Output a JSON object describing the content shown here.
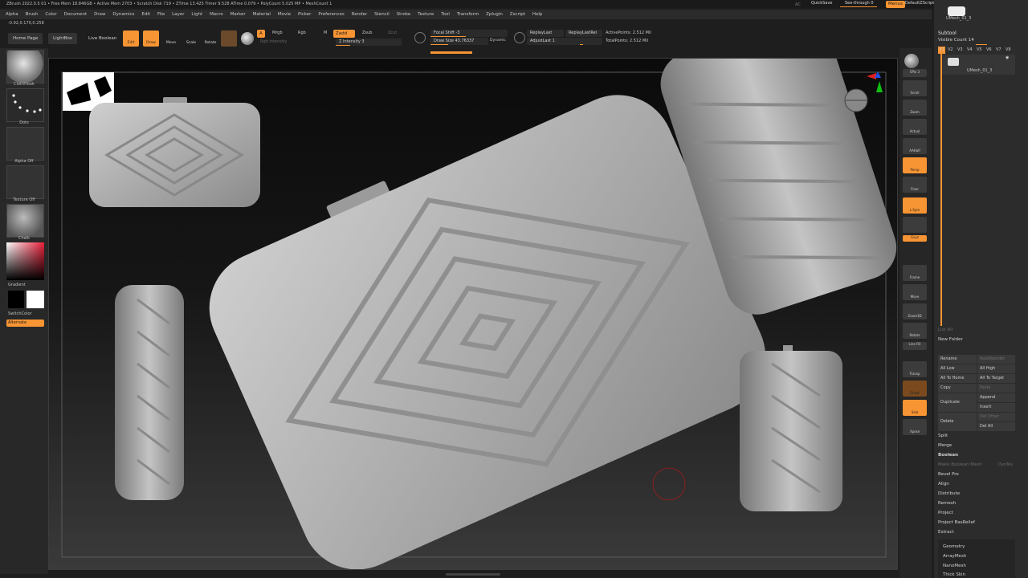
{
  "title_bar": "ZBrush 2022.0.5   01  • Free Mem 18.846GB • Active Mem 2703 • Scratch Disk 719 • ZTime 13.425 Timer 9.528 ATime 0.079 • PolyCount 5.025 MP • MeshCount 1",
  "window_controls": {
    "ac": "AC",
    "quicksave": "QuickSave",
    "see_through": "See-through  0",
    "menus": "Menus",
    "script": "DefaultZScript"
  },
  "menu": [
    "Alpha",
    "Brush",
    "Color",
    "Document",
    "Draw",
    "Dynamics",
    "Edit",
    "File",
    "Layer",
    "Light",
    "Macro",
    "Marker",
    "Material",
    "Movie",
    "Picker",
    "Preferences",
    "Render",
    "Stencil",
    "Stroke",
    "Texture",
    "Tool",
    "Transform",
    "Zplugin",
    "Zscript",
    "Help"
  ],
  "coords": "-0.92,0.170,0.258",
  "toolbar": {
    "home_page": "Home Page",
    "lightbox": "LightBox",
    "live_boolean": "Live Boolean",
    "edit": "Edit",
    "draw": "Draw",
    "move": "Move",
    "scale": "Scale",
    "rotate": "Rotate",
    "a": "A",
    "mrgb": "Mrgb",
    "rgb": "Rgb",
    "m": "M",
    "zadd": "Zadd",
    "zsub": "Zsub",
    "zcut": "Zcut",
    "rgb_intensity": "Rgb Intensity",
    "z_intensity": "Z Intensity 3",
    "focal_shift": "Focal Shift -3",
    "draw_size": "Draw Size 43.76337",
    "dynamic": "Dynamic",
    "replay_last": "ReplayLast",
    "replay_last_rel": "ReplayLastRel",
    "adjust_last": "AdjustLast 1",
    "active_points": "ActivePoints: 2.512 Mil",
    "total_points": "TotalPoints: 2.512 Mil"
  },
  "left_panel": {
    "brush": "ClothHook",
    "stroke": "Dots",
    "alpha": "Alpha Off",
    "texture": "Texture Off",
    "material": "Chalk",
    "gradient": "Gradient",
    "switch_color": "SwitchColor",
    "alternate": "Alternate"
  },
  "right_shelf": [
    "SPix 3",
    "Scroll",
    "Zoom",
    "Actual",
    "AAHalf",
    "Persp",
    "Floor",
    "L.Sym",
    "Gxyz",
    "Frame",
    "Move",
    "Zoom3D",
    "Rotate",
    "Line Fill",
    "PolyF",
    "Transp",
    "Ghost",
    "Solo",
    "Xpose"
  ],
  "subtool": {
    "tool_name": "UMesh_01_3",
    "header": "Subtool",
    "visible_count": "Visible Count 14",
    "versions": [
      "V1",
      "V2",
      "V3",
      "V4",
      "V5",
      "V6",
      "V7",
      "V8"
    ],
    "item_name": "UMesh_01_3",
    "list_all": "List All",
    "new_folder": "New Folder",
    "buttons": [
      [
        "Rename",
        "AutoReorder"
      ],
      [
        "All Low",
        "All High"
      ],
      [
        "All To Home",
        "All To Target"
      ],
      [
        "Copy",
        "Paste"
      ],
      [
        "Duplicate",
        "Append"
      ],
      [
        "",
        "Insert"
      ],
      [
        "Delete",
        "Del Other"
      ],
      [
        "",
        "Del All"
      ]
    ],
    "list": [
      "Split",
      "Merge",
      "Boolean",
      "Make Boolean Mesh",
      "Bevel Pro",
      "Align",
      "Distribute",
      "Remesh",
      "Project",
      "Project BasRelief",
      "Extract"
    ],
    "dyntes": "DynTes"
  },
  "tray_sections": [
    "Geometry",
    "ArrayMesh",
    "NanoMesh",
    "Thick Skin"
  ]
}
